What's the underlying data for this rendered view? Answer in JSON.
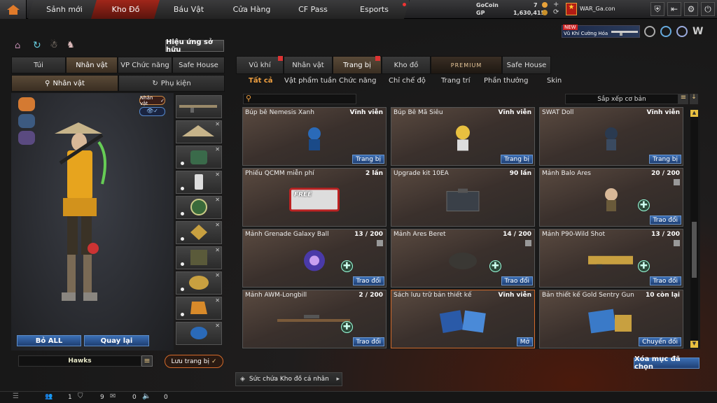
{
  "nav": {
    "tabs": [
      "Sảnh mới",
      "Kho Đồ",
      "Báu Vật",
      "Cửa Hàng",
      "CF Pass",
      "Esports"
    ]
  },
  "currency": {
    "gocoin_label": "GoCoin",
    "gocoin_value": "7",
    "gp_label": "GP",
    "gp_value": "1,630,415"
  },
  "user": {
    "name": "WAR_Ga.con"
  },
  "promo": {
    "new": "NEW",
    "text": "Vũ Khí Cường Hóa"
  },
  "left": {
    "effect_btn": "Hiệu ứng sở hữu",
    "tabs": [
      "Túi",
      "Nhân vật",
      "VP Chức năng",
      "Safe House"
    ],
    "subtabs": [
      "Nhân vật",
      "Phụ kiện"
    ],
    "char_badge": "Nhân vật",
    "remove_all": "Bỏ ALL",
    "back": "Quay lại",
    "preset_name": "Hawks",
    "save": "Lưu trang bị"
  },
  "right": {
    "tabs": [
      "Vũ khí",
      "Nhân vật",
      "Trang bị",
      "Kho đồ",
      "PREMIUM",
      "Safe House"
    ],
    "subtabs": [
      "Tất cả",
      "Vật phẩm tuần",
      "Chức năng",
      "Chỉ chế độ",
      "Trang trí",
      "Phần thưởng",
      "Skin"
    ],
    "sort": "Sắp xếp cơ bản",
    "clear_selected": "Xóa mục đã chọn",
    "capacity": "Sức chứa Kho đồ cá nhân",
    "items": [
      {
        "name": "Búp bê Nemesis Xanh",
        "count": "Vĩnh viễn",
        "action": "Trang bị"
      },
      {
        "name": "Búp Bê Mã Siêu",
        "count": "Vĩnh viễn",
        "action": "Trang bị"
      },
      {
        "name": "SWAT Doll",
        "count": "Vĩnh viễn",
        "action": "Trang bị"
      },
      {
        "name": "Phiếu QCMM miễn phí",
        "count": "2 lần",
        "action": ""
      },
      {
        "name": "Upgrade kit 10EA",
        "count": "90 lần",
        "action": ""
      },
      {
        "name": "Mảnh Balo Ares",
        "count": "20 / 200",
        "action": "Trao đổi"
      },
      {
        "name": "Mảnh Grenade Galaxy Ball",
        "count": "13 / 200",
        "action": "Trao đổi"
      },
      {
        "name": "Mảnh Ares Beret",
        "count": "14 / 200",
        "action": "Trao đổi"
      },
      {
        "name": "Mảnh P90-Wild Shot",
        "count": "13 / 200",
        "action": "Trao đổi"
      },
      {
        "name": "Mảnh AWM-Longbill",
        "count": "2 / 200",
        "action": "Trao đổi"
      },
      {
        "name": "Sách lưu trữ bản thiết kế",
        "count": "Vĩnh viễn",
        "action": "Mở"
      },
      {
        "name": "Bản thiết kế Gold Sentry Gun",
        "count": "10 còn lại",
        "action": "Chuyển đổi"
      }
    ],
    "free_label": "FREE"
  },
  "bottom": {
    "v1": "1",
    "v2": "9",
    "v3": "0",
    "v4": "0"
  }
}
